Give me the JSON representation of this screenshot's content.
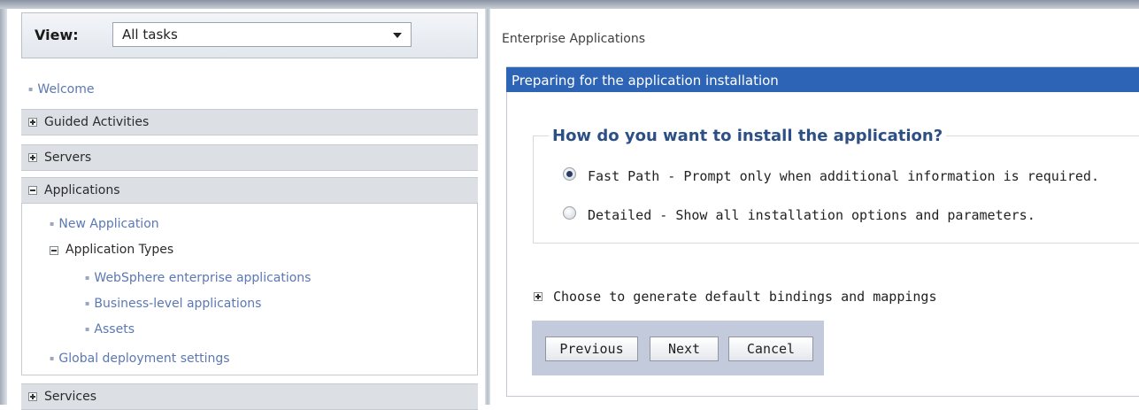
{
  "nav": {
    "view_label": "View:",
    "view_value": "All tasks",
    "welcome": "Welcome",
    "sections": {
      "guided": "Guided Activities",
      "servers": "Servers",
      "applications": "Applications",
      "services": "Services"
    },
    "app_items": {
      "new_application": "New Application",
      "application_types": "Application Types",
      "websphere": "WebSphere enterprise applications",
      "business_level": "Business-level applications",
      "assets": "Assets",
      "global_settings": "Global deployment settings"
    }
  },
  "main": {
    "breadcrumb": "Enterprise Applications",
    "panel_title": "Preparing for the application installation",
    "question": "How do you want to install the application?",
    "options": [
      {
        "label": "Fast Path - Prompt only when additional information is required.",
        "selected": true
      },
      {
        "label": "Detailed - Show all installation options and parameters.",
        "selected": false
      }
    ],
    "expand_label": "Choose to generate default bindings and mappings",
    "buttons": {
      "previous": "Previous",
      "next": "Next",
      "cancel": "Cancel"
    }
  },
  "colors": {
    "header_blue": "#2e64b5",
    "link_blue": "#5b78b3",
    "legend_blue": "#2c4f86",
    "button_bar": "#c2cadc"
  }
}
